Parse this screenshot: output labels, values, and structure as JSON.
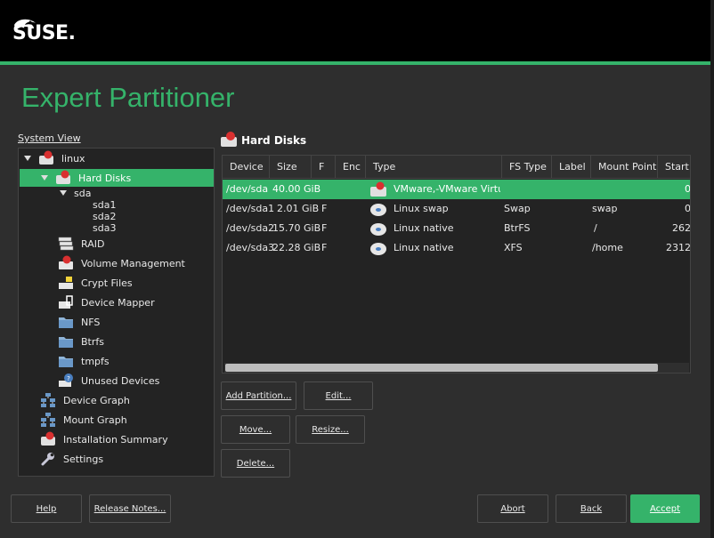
{
  "brand": {
    "logo_text": "SUSE."
  },
  "page_title": "Expert Partitioner",
  "tree": {
    "label": "System View",
    "nodes": [
      {
        "label": "linux"
      },
      {
        "label": "Hard Disks"
      },
      {
        "label": "sda"
      },
      {
        "label": "sda1"
      },
      {
        "label": "sda2"
      },
      {
        "label": "sda3"
      },
      {
        "label": "RAID"
      },
      {
        "label": "Volume Management"
      },
      {
        "label": "Crypt Files"
      },
      {
        "label": "Device Mapper"
      },
      {
        "label": "NFS"
      },
      {
        "label": "Btrfs"
      },
      {
        "label": "tmpfs"
      },
      {
        "label": "Unused Devices"
      },
      {
        "label": "Device Graph"
      },
      {
        "label": "Mount Graph"
      },
      {
        "label": "Installation Summary"
      },
      {
        "label": "Settings"
      }
    ]
  },
  "panel": {
    "title": "Hard Disks",
    "columns": [
      "Device",
      "Size",
      "F",
      "Enc",
      "Type",
      "FS Type",
      "Label",
      "Mount Point",
      "Start"
    ],
    "rows": [
      {
        "device": "/dev/sda",
        "size": "40.00 GiB",
        "f": "",
        "enc": "",
        "type": "VMware,-VMware Virtual S",
        "fs": "",
        "label": "",
        "mount": "",
        "start": "0"
      },
      {
        "device": "/dev/sda1",
        "size": "2.01 GiB",
        "f": "F",
        "enc": "",
        "type": "Linux swap",
        "fs": "Swap",
        "label": "",
        "mount": "swap",
        "start": "0"
      },
      {
        "device": "/dev/sda2",
        "size": "15.70 GiB",
        "f": "F",
        "enc": "",
        "type": "Linux native",
        "fs": "BtrFS",
        "label": "",
        "mount": "/",
        "start": "262"
      },
      {
        "device": "/dev/sda3",
        "size": "22.28 GiB",
        "f": "F",
        "enc": "",
        "type": "Linux native",
        "fs": "XFS",
        "label": "",
        "mount": "/home",
        "start": "2312"
      }
    ]
  },
  "actions": {
    "add_partition": "Add Partition...",
    "edit": "Edit...",
    "move": "Move...",
    "resize": "Resize...",
    "delete": "Delete..."
  },
  "footer": {
    "help": "Help",
    "release_notes": "Release Notes...",
    "abort": "Abort",
    "back": "Back",
    "accept": "Accept"
  },
  "colors": {
    "accent": "#35b36a",
    "background": "#2e2e2e",
    "banner": "#000000"
  }
}
